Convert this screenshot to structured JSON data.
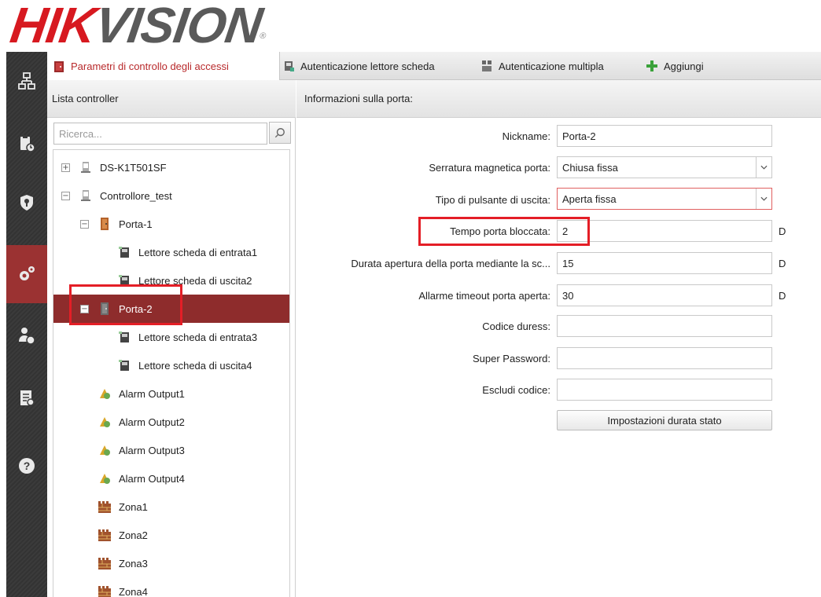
{
  "logo": {
    "part1": "HIK",
    "part2": "VISION",
    "reg": "®"
  },
  "rail": {
    "items": [
      {
        "icon": "device-tree-icon"
      },
      {
        "icon": "clipboard-clock-icon"
      },
      {
        "icon": "shield-icon"
      },
      {
        "icon": "gears-icon",
        "active": true
      },
      {
        "icon": "fingerprint-user-icon"
      },
      {
        "icon": "document-search-icon"
      },
      {
        "icon": "help-icon"
      }
    ]
  },
  "tabs": [
    {
      "label": "Parametri di controllo degli accessi",
      "active": true
    },
    {
      "label": "Autenticazione lettore scheda"
    },
    {
      "label": "Autenticazione multipla"
    },
    {
      "label": "Aggiungi"
    }
  ],
  "left_panel": {
    "title": "Lista controller",
    "search_placeholder": "Ricerca...",
    "tree": [
      {
        "label": "DS-K1T501SF",
        "expander": "+",
        "icon": "controller-icon"
      },
      {
        "label": "Controllore_test",
        "expander": "−",
        "icon": "controller-icon"
      },
      {
        "label": "Porta-1",
        "expander": "−",
        "icon": "door-icon"
      },
      {
        "label": "Lettore scheda di entrata1",
        "icon": "card-reader-icon"
      },
      {
        "label": "Lettore scheda di uscita2",
        "icon": "card-reader-icon"
      },
      {
        "label": "Porta-2",
        "expander": "−",
        "icon": "door-icon",
        "selected": true
      },
      {
        "label": "Lettore scheda di entrata3",
        "icon": "card-reader-icon"
      },
      {
        "label": "Lettore scheda di uscita4",
        "icon": "card-reader-icon"
      },
      {
        "label": "Alarm Output1",
        "icon": "alarm-output-icon"
      },
      {
        "label": "Alarm Output2",
        "icon": "alarm-output-icon"
      },
      {
        "label": "Alarm Output3",
        "icon": "alarm-output-icon"
      },
      {
        "label": "Alarm Output4",
        "icon": "alarm-output-icon"
      },
      {
        "label": "Zona1",
        "icon": "zone-icon"
      },
      {
        "label": "Zona2",
        "icon": "zone-icon"
      },
      {
        "label": "Zona3",
        "icon": "zone-icon"
      },
      {
        "label": "Zona4",
        "icon": "zone-icon"
      }
    ]
  },
  "right_panel": {
    "title": "Informazioni sulla porta:",
    "fields": {
      "nickname": {
        "label": "Nickname:",
        "value": "Porta-2"
      },
      "serratura": {
        "label": "Serratura magnetica porta:",
        "value": "Chiusa fissa"
      },
      "pulsante": {
        "label": "Tipo di pulsante di uscita:",
        "value": "Aperta fissa"
      },
      "tempo": {
        "label": "Tempo porta bloccata:",
        "value": "2",
        "unit": "D"
      },
      "durata": {
        "label": "Durata apertura della porta mediante la sc...",
        "value": "15",
        "unit": "D"
      },
      "allarme": {
        "label": "Allarme timeout porta aperta:",
        "value": "30",
        "unit": "D"
      },
      "duress": {
        "label": "Codice duress:",
        "value": ""
      },
      "superpw": {
        "label": "Super Password:",
        "value": ""
      },
      "escludi": {
        "label": "Escludi codice:",
        "value": ""
      }
    },
    "button": "Impostazioni durata stato"
  },
  "colors": {
    "brand_red": "#d71920",
    "active_tab_text": "#b8292b",
    "selected_row": "#8e2c2c",
    "highlight": "#e41e26",
    "rail": "#3b3b3b"
  }
}
